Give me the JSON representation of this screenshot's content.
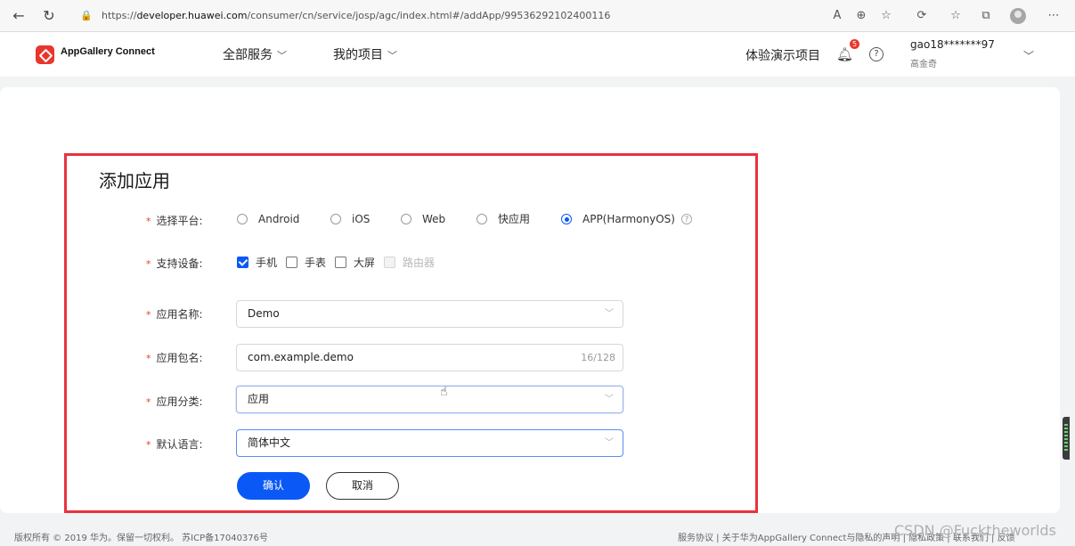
{
  "browser": {
    "url_prefix": "https://",
    "url_host": "developer.huawei.com",
    "url_path": "/consumer/cn/service/josp/agc/index.html#/addApp/99536292102400116"
  },
  "header": {
    "brand": "AppGallery Connect",
    "menus": [
      "全部服务",
      "我的项目"
    ],
    "demo_project": "体验演示项目",
    "notification_count": "5",
    "username": "gao18*******97",
    "realname": "高金奇"
  },
  "form": {
    "title": "添加应用",
    "platform": {
      "label": "选择平台:",
      "options": [
        "Android",
        "iOS",
        "Web",
        "快应用",
        "APP(HarmonyOS)"
      ],
      "selected": "APP(HarmonyOS)"
    },
    "devices": {
      "label": "支持设备:",
      "options": [
        "手机",
        "手表",
        "大屏",
        "路由器"
      ],
      "checked": [
        "手机"
      ],
      "disabled": [
        "路由器"
      ]
    },
    "app_name": {
      "label": "应用名称:",
      "value": "Demo"
    },
    "package_name": {
      "label": "应用包名:",
      "value": "com.example.demo",
      "counter": "16/128"
    },
    "category": {
      "label": "应用分类:",
      "value": "应用"
    },
    "language": {
      "label": "默认语言:",
      "value": "简体中文"
    },
    "required_mark": "*",
    "confirm_label": "确认",
    "cancel_label": "取消"
  },
  "footer": {
    "copyright": "版权所有 © 2019 华为。保留一切权利。 苏ICP备17040376号",
    "links": "服务协议 | 关于华为AppGallery Connect与隐私的声明 | 隐私政策 | 联系我们 | 反馈"
  },
  "watermark": "CSDN @Fucktheworlds",
  "colors": {
    "primary": "#0a59f7",
    "highlight": "#e8333e",
    "brand_red": "#e8362d"
  }
}
